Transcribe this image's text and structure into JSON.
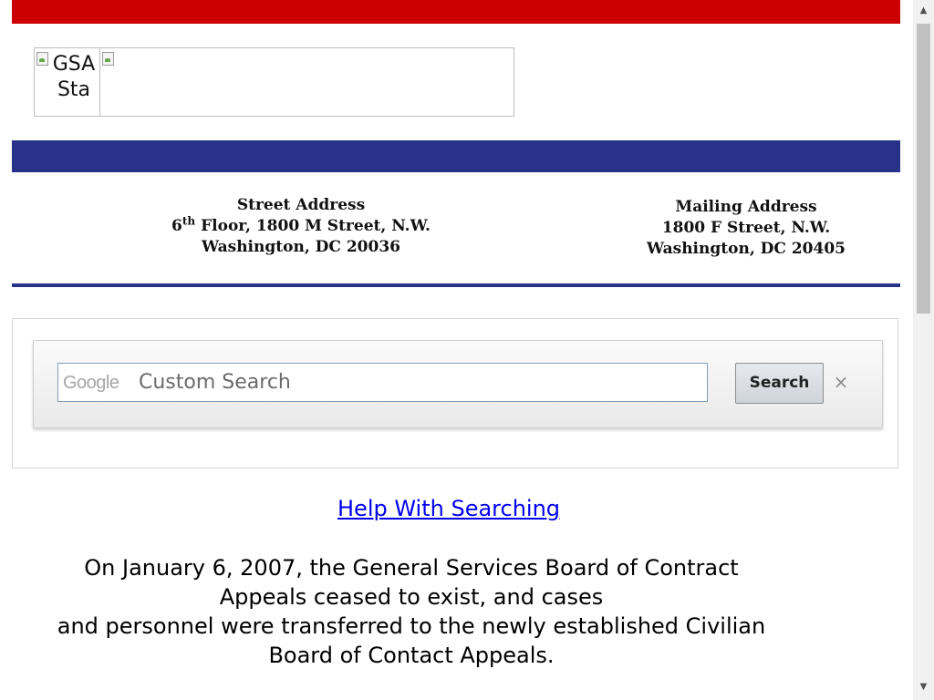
{
  "header": {
    "logo_alt_text": "GSA Sta",
    "red_bar_color": "#cc0000",
    "blue_bar_color": "#283288"
  },
  "street_address": {
    "heading": "Street Address",
    "floor_number": "6",
    "floor_suffix": "th",
    "line1_rest": " Floor, 1800 M Street, N.W.",
    "line2": "Washington, DC 20036"
  },
  "mailing_address": {
    "heading": "Mailing Address",
    "line1": "1800 F Street, N.W.",
    "line2": "Washington, DC 20405"
  },
  "search": {
    "brand": "Google",
    "placeholder": "Custom Search",
    "button_label": "Search",
    "clear_label": "×"
  },
  "help_link": "Help With Searching",
  "notice": {
    "lines": [
      "On January 6, 2007, the General Services Board of Contract",
      "Appeals ceased to exist, and cases",
      "and personnel were transferred to the newly established Civilian",
      "Board of Contact Appeals."
    ]
  },
  "scrollbar": {
    "up_arrow": "▲",
    "down_arrow": "▼"
  }
}
